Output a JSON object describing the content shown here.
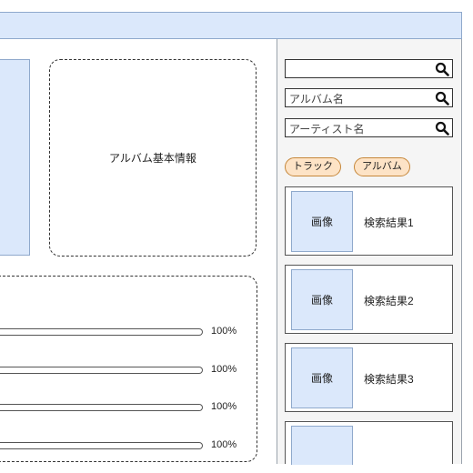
{
  "album_info": {
    "label": "アルバム基本情報"
  },
  "tracks": [
    {
      "progress": "100%"
    },
    {
      "progress": "100%"
    },
    {
      "progress": "100%"
    },
    {
      "progress": "100%"
    }
  ],
  "search": {
    "fields": [
      {
        "placeholder": "",
        "icon": "search-icon"
      },
      {
        "placeholder": "アルバム名",
        "icon": "search-icon"
      },
      {
        "placeholder": "アーティスト名",
        "icon": "search-icon"
      }
    ],
    "filters": [
      {
        "label": "トラック"
      },
      {
        "label": "アルバム"
      }
    ]
  },
  "results": [
    {
      "thumb_label": "画像",
      "title": "検索結果1"
    },
    {
      "thumb_label": "画像",
      "title": "検索結果2"
    },
    {
      "thumb_label": "画像",
      "title": "検索結果3"
    },
    {
      "thumb_label": "",
      "title": ""
    }
  ],
  "colors": {
    "panel_blue": "#dbe8fb",
    "chip_orange": "#fde3c6",
    "sidebar_bg": "#f5f5f5"
  }
}
